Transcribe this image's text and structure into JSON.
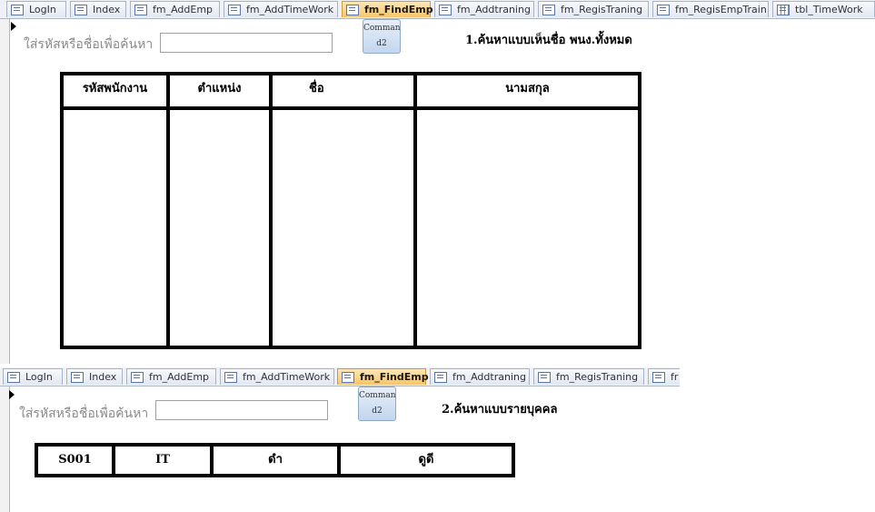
{
  "form1": {
    "tabs": [
      {
        "label": "LogIn",
        "icon": "form-icon"
      },
      {
        "label": "Index",
        "icon": "form-icon"
      },
      {
        "label": "fm_AddEmp",
        "icon": "form-icon"
      },
      {
        "label": "fm_AddTimeWork",
        "icon": "form-icon"
      },
      {
        "label": "fm_FindEmp",
        "icon": "form-icon",
        "active": true
      },
      {
        "label": "fm_Addtraning",
        "icon": "form-icon"
      },
      {
        "label": "fm_RegisTraning",
        "icon": "form-icon"
      },
      {
        "label": "fm_RegisEmpTrain",
        "icon": "form-icon"
      },
      {
        "label": "tbl_TimeWork",
        "icon": "table-icon"
      }
    ],
    "search_prompt": "ใส่รหัสหรือชื่อเพื่อค้นหา",
    "search_value": "",
    "command_button": {
      "line1": "Comman",
      "line2": "d2"
    },
    "heading": "1.ค้นหาแบบเห็นชื่อ พนง.ทั้งหมด",
    "columns": [
      "รหัสพนักงาน",
      "ตำแหน่ง",
      "ชื่อ",
      "นามสกุล"
    ]
  },
  "form2": {
    "tabs": [
      {
        "label": "LogIn",
        "icon": "form-icon"
      },
      {
        "label": "Index",
        "icon": "form-icon"
      },
      {
        "label": "fm_AddEmp",
        "icon": "form-icon"
      },
      {
        "label": "fm_AddTimeWork",
        "icon": "form-icon"
      },
      {
        "label": "fm_FindEmp",
        "icon": "form-icon",
        "active": true
      },
      {
        "label": "fm_Addtraning",
        "icon": "form-icon"
      },
      {
        "label": "fm_RegisTraning",
        "icon": "form-icon"
      },
      {
        "label": "fr",
        "icon": "form-icon"
      }
    ],
    "search_prompt": "ใส่รหัสหรือชื่อเพื่อค้นหา",
    "search_value": "",
    "command_button": {
      "line1": "Comman",
      "line2": "d2"
    },
    "heading": "2.ค้นหาแบบรายบุคคล",
    "record": [
      "S001",
      "IT",
      "ดำ",
      "ดูดี"
    ]
  }
}
